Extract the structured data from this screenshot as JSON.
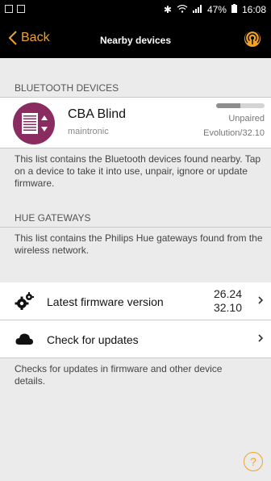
{
  "status_bar": {
    "battery": "47%",
    "time": "16:08"
  },
  "nav": {
    "back_label": "Back",
    "title": "Nearby devices"
  },
  "bluetooth": {
    "header": "BLUETOOTH DEVICES",
    "device": {
      "name": "CBA Blind",
      "vendor": "maintronic",
      "status": "Unpaired",
      "firmware": "Evolution/32.10",
      "signal_fraction": 0.5
    },
    "description": "This list contains the Bluetooth devices found nearby. Tap on a device to take it into use, unpair, ignore or update firmware."
  },
  "hue": {
    "header": "HUE GATEWAYS",
    "description": "This list contains the Philips Hue gateways found from the wireless network."
  },
  "firmware_row": {
    "label": "Latest firmware version",
    "value_1": "26.24",
    "value_2": "32.10"
  },
  "updates_row": {
    "label": "Check for updates"
  },
  "updates_description": "Checks for updates in firmware and other device details.",
  "help": {
    "label": "?"
  },
  "colors": {
    "accent": "#f2a226",
    "avatar": "#8a2c5f"
  }
}
